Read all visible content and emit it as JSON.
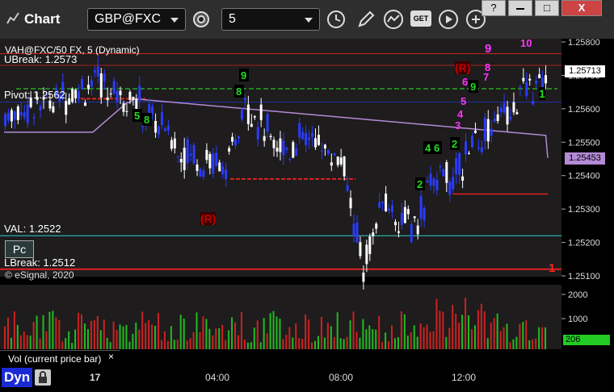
{
  "titlebar": {
    "app_title": "Chart",
    "symbol": "GBP@FXC",
    "interval": "5",
    "window_buttons": [
      "?",
      "",
      "□",
      "X"
    ],
    "get_label": "GET"
  },
  "chart": {
    "header": "VAH@FXC/50 FX, 5 (Dynamic)",
    "ubreak": "UBreak: 1.2573",
    "pivot": "Pivot: 1.2562",
    "val": "VAL: 1.2522",
    "lbreak": "LBreak: 1.2512",
    "copyright": "© eSignal, 2020",
    "pc_badge": "Pc",
    "last_price": "1.25713",
    "ma_price": "1.25453",
    "r_marker": "(R)",
    "r_marker_top": "(R)",
    "price_ticks": [
      "1.25800",
      "1.25700",
      "1.25600",
      "1.25500",
      "1.25400",
      "1.25300",
      "1.25200",
      "1.25100"
    ],
    "nine_top": "9",
    "ten_top": "10",
    "one_right": "1",
    "one_bottom": "1"
  },
  "volume": {
    "label": "Vol (current price bar)",
    "ticks": [
      "2000",
      "1000"
    ],
    "current": "206"
  },
  "time_axis": {
    "dyn_label": "Dyn",
    "ticks": [
      "17",
      "04:00",
      "08:00",
      "12:00"
    ]
  },
  "colors": {
    "up_candle": "#ffffff",
    "down_candle": "#2a3cff",
    "ma_line": "#b38ad6",
    "vah_line": "#22aa22",
    "val_line": "#33cccc",
    "break_line": "#dd2222",
    "panel_bg": "#1e1c1c"
  }
}
